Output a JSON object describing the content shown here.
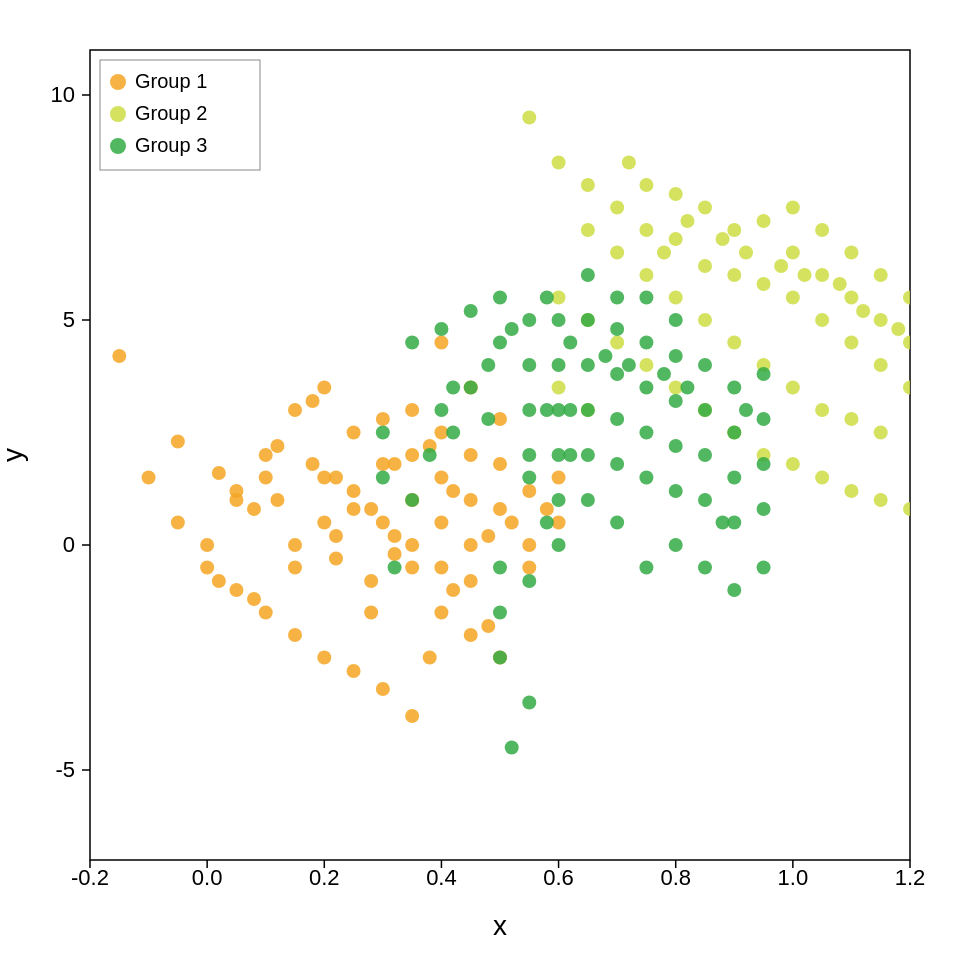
{
  "chart": {
    "title": "",
    "xLabel": "x",
    "yLabel": "y",
    "xMin": -0.2,
    "xMax": 1.2,
    "yMin": -7,
    "yMax": 11,
    "xTicks": [
      -0.2,
      0.0,
      0.2,
      0.4,
      0.6,
      0.8,
      1.0,
      1.2
    ],
    "yTicks": [
      -5,
      0,
      5,
      10
    ],
    "legend": [
      {
        "label": "Group 1",
        "color": "#F5A623"
      },
      {
        "label": "Group 2",
        "color": "#CCDD44"
      },
      {
        "label": "Group 3",
        "color": "#33AA44"
      }
    ],
    "groups": {
      "group1": {
        "color": "#F5A623",
        "points": [
          [
            -0.15,
            4.2
          ],
          [
            -0.05,
            2.3
          ],
          [
            0.02,
            1.6
          ],
          [
            0.05,
            1.2
          ],
          [
            0.08,
            0.8
          ],
          [
            0.1,
            1.5
          ],
          [
            0.12,
            1.0
          ],
          [
            0.15,
            0.0
          ],
          [
            0.15,
            -0.5
          ],
          [
            0.18,
            1.8
          ],
          [
            0.2,
            1.5
          ],
          [
            0.2,
            0.5
          ],
          [
            0.22,
            0.2
          ],
          [
            0.22,
            -0.3
          ],
          [
            0.25,
            2.5
          ],
          [
            0.25,
            1.2
          ],
          [
            0.25,
            0.8
          ],
          [
            0.28,
            -0.8
          ],
          [
            0.28,
            -1.5
          ],
          [
            0.3,
            2.8
          ],
          [
            0.3,
            1.8
          ],
          [
            0.3,
            0.5
          ],
          [
            0.32,
            0.2
          ],
          [
            0.32,
            -0.2
          ],
          [
            0.35,
            3.0
          ],
          [
            0.35,
            2.0
          ],
          [
            0.35,
            1.0
          ],
          [
            0.35,
            0.0
          ],
          [
            0.35,
            -0.5
          ],
          [
            0.38,
            -2.5
          ],
          [
            0.4,
            4.5
          ],
          [
            0.4,
            2.5
          ],
          [
            0.4,
            1.5
          ],
          [
            0.4,
            0.5
          ],
          [
            0.4,
            -0.5
          ],
          [
            0.42,
            -1.0
          ],
          [
            0.45,
            3.5
          ],
          [
            0.45,
            2.0
          ],
          [
            0.45,
            1.0
          ],
          [
            0.45,
            0.0
          ],
          [
            0.45,
            -0.8
          ],
          [
            0.48,
            -1.8
          ],
          [
            0.5,
            2.8
          ],
          [
            0.5,
            1.8
          ],
          [
            0.5,
            0.8
          ],
          [
            -0.1,
            1.5
          ],
          [
            -0.05,
            0.5
          ],
          [
            0.0,
            -0.5
          ],
          [
            0.05,
            -1.0
          ],
          [
            0.1,
            -1.5
          ],
          [
            0.15,
            -2.0
          ],
          [
            0.2,
            -2.5
          ],
          [
            0.25,
            -2.8
          ],
          [
            0.3,
            -3.2
          ],
          [
            0.35,
            -3.8
          ],
          [
            0.4,
            -1.5
          ],
          [
            0.45,
            -2.0
          ],
          [
            0.5,
            -2.5
          ],
          [
            0.52,
            0.5
          ],
          [
            0.55,
            1.2
          ],
          [
            0.55,
            0.0
          ],
          [
            0.55,
            -0.5
          ],
          [
            0.58,
            0.8
          ],
          [
            0.6,
            1.5
          ],
          [
            0.6,
            0.5
          ],
          [
            0.0,
            0.0
          ],
          [
            0.05,
            1.0
          ],
          [
            0.1,
            2.0
          ],
          [
            0.15,
            3.0
          ],
          [
            0.2,
            3.5
          ],
          [
            0.02,
            -0.8
          ],
          [
            0.08,
            -1.2
          ],
          [
            0.12,
            2.2
          ],
          [
            0.18,
            3.2
          ],
          [
            0.22,
            1.5
          ],
          [
            0.28,
            0.8
          ],
          [
            0.32,
            1.8
          ],
          [
            0.38,
            2.2
          ],
          [
            0.42,
            1.2
          ],
          [
            0.48,
            0.2
          ]
        ]
      },
      "group2": {
        "color": "#CCDD44",
        "points": [
          [
            0.55,
            9.5
          ],
          [
            0.6,
            8.5
          ],
          [
            0.65,
            8.0
          ],
          [
            0.7,
            7.5
          ],
          [
            0.72,
            8.5
          ],
          [
            0.75,
            7.0
          ],
          [
            0.75,
            8.0
          ],
          [
            0.78,
            6.5
          ],
          [
            0.8,
            7.8
          ],
          [
            0.8,
            6.8
          ],
          [
            0.82,
            7.2
          ],
          [
            0.85,
            7.5
          ],
          [
            0.85,
            6.2
          ],
          [
            0.88,
            6.8
          ],
          [
            0.9,
            7.0
          ],
          [
            0.9,
            6.0
          ],
          [
            0.92,
            6.5
          ],
          [
            0.95,
            7.2
          ],
          [
            0.95,
            5.8
          ],
          [
            0.98,
            6.2
          ],
          [
            1.0,
            7.5
          ],
          [
            1.0,
            6.5
          ],
          [
            1.0,
            5.5
          ],
          [
            1.02,
            6.0
          ],
          [
            1.05,
            7.0
          ],
          [
            1.05,
            6.0
          ],
          [
            1.05,
            5.0
          ],
          [
            1.08,
            5.8
          ],
          [
            1.1,
            6.5
          ],
          [
            1.1,
            5.5
          ],
          [
            1.1,
            4.5
          ],
          [
            1.12,
            5.2
          ],
          [
            1.15,
            6.0
          ],
          [
            1.15,
            5.0
          ],
          [
            1.15,
            4.0
          ],
          [
            1.18,
            4.8
          ],
          [
            1.2,
            5.5
          ],
          [
            1.2,
            4.5
          ],
          [
            1.2,
            3.5
          ],
          [
            0.65,
            7.0
          ],
          [
            0.7,
            6.5
          ],
          [
            0.75,
            6.0
          ],
          [
            0.8,
            5.5
          ],
          [
            0.85,
            5.0
          ],
          [
            0.9,
            4.5
          ],
          [
            0.95,
            4.0
          ],
          [
            1.0,
            3.5
          ],
          [
            1.05,
            3.0
          ],
          [
            1.1,
            2.8
          ],
          [
            1.15,
            2.5
          ],
          [
            0.6,
            5.5
          ],
          [
            0.65,
            5.0
          ],
          [
            0.7,
            4.5
          ],
          [
            0.75,
            4.0
          ],
          [
            0.8,
            3.5
          ],
          [
            0.85,
            3.0
          ],
          [
            0.9,
            2.5
          ],
          [
            0.95,
            2.0
          ],
          [
            1.0,
            1.8
          ],
          [
            1.05,
            1.5
          ],
          [
            1.1,
            1.2
          ],
          [
            1.15,
            1.0
          ],
          [
            1.2,
            0.8
          ],
          [
            0.6,
            3.5
          ],
          [
            0.65,
            3.0
          ]
        ]
      },
      "group3": {
        "color": "#33AA44",
        "points": [
          [
            0.3,
            2.5
          ],
          [
            0.35,
            4.5
          ],
          [
            0.4,
            4.8
          ],
          [
            0.42,
            3.5
          ],
          [
            0.45,
            5.2
          ],
          [
            0.48,
            4.0
          ],
          [
            0.5,
            5.5
          ],
          [
            0.5,
            4.5
          ],
          [
            0.52,
            4.8
          ],
          [
            0.55,
            5.0
          ],
          [
            0.55,
            4.0
          ],
          [
            0.55,
            3.0
          ],
          [
            0.58,
            5.5
          ],
          [
            0.6,
            5.0
          ],
          [
            0.6,
            4.0
          ],
          [
            0.6,
            3.0
          ],
          [
            0.62,
            4.5
          ],
          [
            0.65,
            5.0
          ],
          [
            0.65,
            4.0
          ],
          [
            0.65,
            3.0
          ],
          [
            0.65,
            2.0
          ],
          [
            0.68,
            4.2
          ],
          [
            0.7,
            4.8
          ],
          [
            0.7,
            3.8
          ],
          [
            0.7,
            2.8
          ],
          [
            0.7,
            1.8
          ],
          [
            0.72,
            4.0
          ],
          [
            0.75,
            4.5
          ],
          [
            0.75,
            3.5
          ],
          [
            0.75,
            2.5
          ],
          [
            0.75,
            1.5
          ],
          [
            0.78,
            3.8
          ],
          [
            0.8,
            4.2
          ],
          [
            0.8,
            3.2
          ],
          [
            0.8,
            2.2
          ],
          [
            0.8,
            1.2
          ],
          [
            0.82,
            3.5
          ],
          [
            0.85,
            4.0
          ],
          [
            0.85,
            3.0
          ],
          [
            0.85,
            2.0
          ],
          [
            0.85,
            1.0
          ],
          [
            0.88,
            0.5
          ],
          [
            0.9,
            3.5
          ],
          [
            0.9,
            2.5
          ],
          [
            0.9,
            1.5
          ],
          [
            0.9,
            0.5
          ],
          [
            0.92,
            3.0
          ],
          [
            0.95,
            3.8
          ],
          [
            0.95,
            2.8
          ],
          [
            0.95,
            1.8
          ],
          [
            0.95,
            0.8
          ],
          [
            0.5,
            -0.5
          ],
          [
            0.5,
            -1.5
          ],
          [
            0.5,
            -2.5
          ],
          [
            0.52,
            -4.5
          ],
          [
            0.55,
            -3.5
          ],
          [
            0.55,
            1.5
          ],
          [
            0.58,
            0.5
          ],
          [
            0.6,
            1.0
          ],
          [
            0.62,
            2.0
          ],
          [
            0.3,
            1.5
          ],
          [
            0.32,
            -0.5
          ],
          [
            0.35,
            1.0
          ],
          [
            0.38,
            2.0
          ],
          [
            0.4,
            3.0
          ],
          [
            0.42,
            2.5
          ],
          [
            0.45,
            3.5
          ],
          [
            0.48,
            2.8
          ],
          [
            0.55,
            2.0
          ],
          [
            0.58,
            3.0
          ],
          [
            0.6,
            2.0
          ],
          [
            0.62,
            3.0
          ],
          [
            0.65,
            6.0
          ],
          [
            0.7,
            5.5
          ],
          [
            0.75,
            5.5
          ],
          [
            0.8,
            5.0
          ],
          [
            0.55,
            -0.8
          ],
          [
            0.6,
            0.0
          ],
          [
            0.65,
            1.0
          ],
          [
            0.7,
            0.5
          ],
          [
            0.75,
            -0.5
          ],
          [
            0.8,
            0.0
          ],
          [
            0.85,
            -0.5
          ],
          [
            0.9,
            -1.0
          ],
          [
            0.95,
            -0.5
          ]
        ]
      }
    }
  }
}
